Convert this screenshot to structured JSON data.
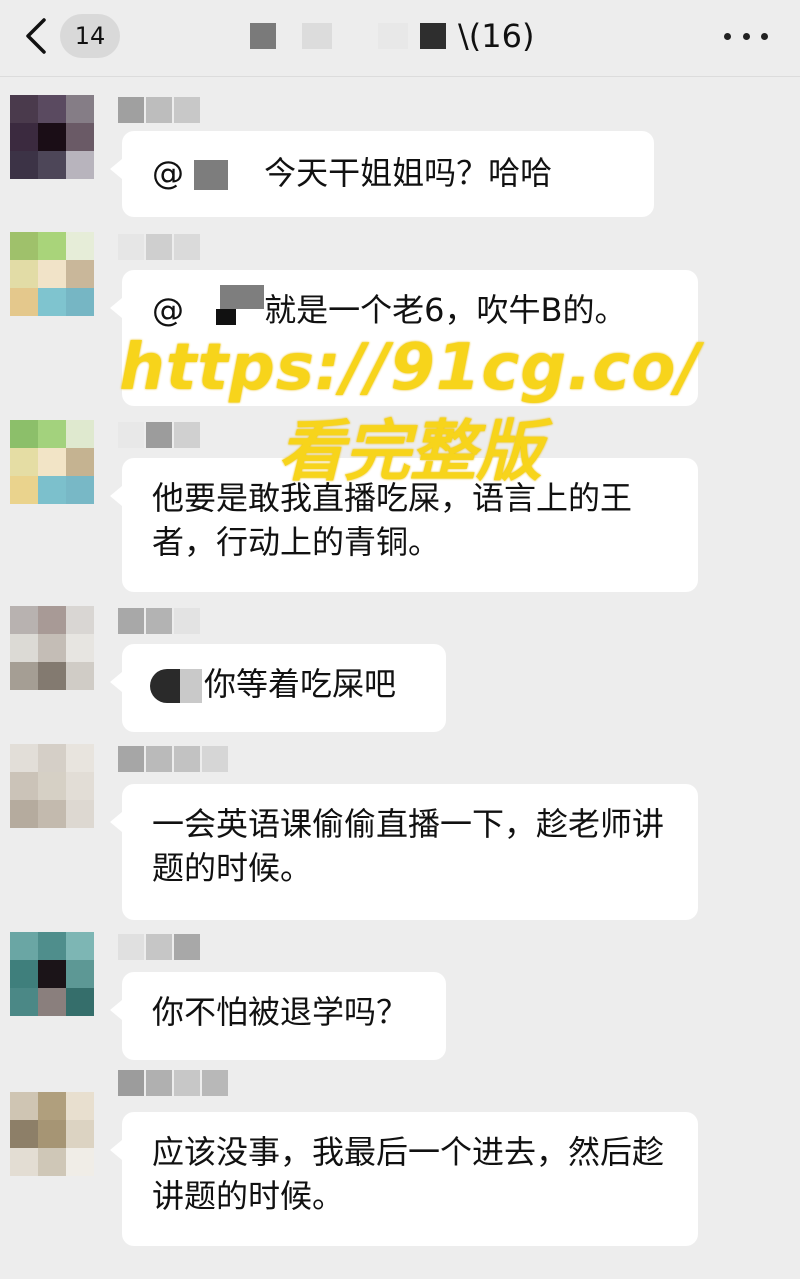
{
  "header": {
    "back_badge": "14",
    "title_visible": "\\(16)"
  },
  "messages": [
    {
      "text_mention_prefix": "@",
      "text": "今天干姐姐吗？哈哈"
    },
    {
      "text_mention_prefix": "@",
      "text": "就是一个老6，吹牛B的。"
    },
    {
      "text": "他要是敢我直播吃屎，语言上的王者，行动上的青铜。"
    },
    {
      "text": "你等着吃屎吧"
    },
    {
      "text": "一会英语课偷偷直播一下，趁老师讲题的时候。"
    },
    {
      "text": "你不怕被退学吗？"
    },
    {
      "text": "应该没事，我最后一个进去，然后趁讲题的时候。"
    }
  ],
  "watermark": {
    "url": "https://91cg.co/",
    "caption": "看完整版"
  },
  "icons": [
    "back-arrow-icon",
    "more-icon"
  ],
  "colors": {
    "background": "#ededed",
    "bubble": "#ffffff",
    "watermark": "#f7d41b"
  }
}
